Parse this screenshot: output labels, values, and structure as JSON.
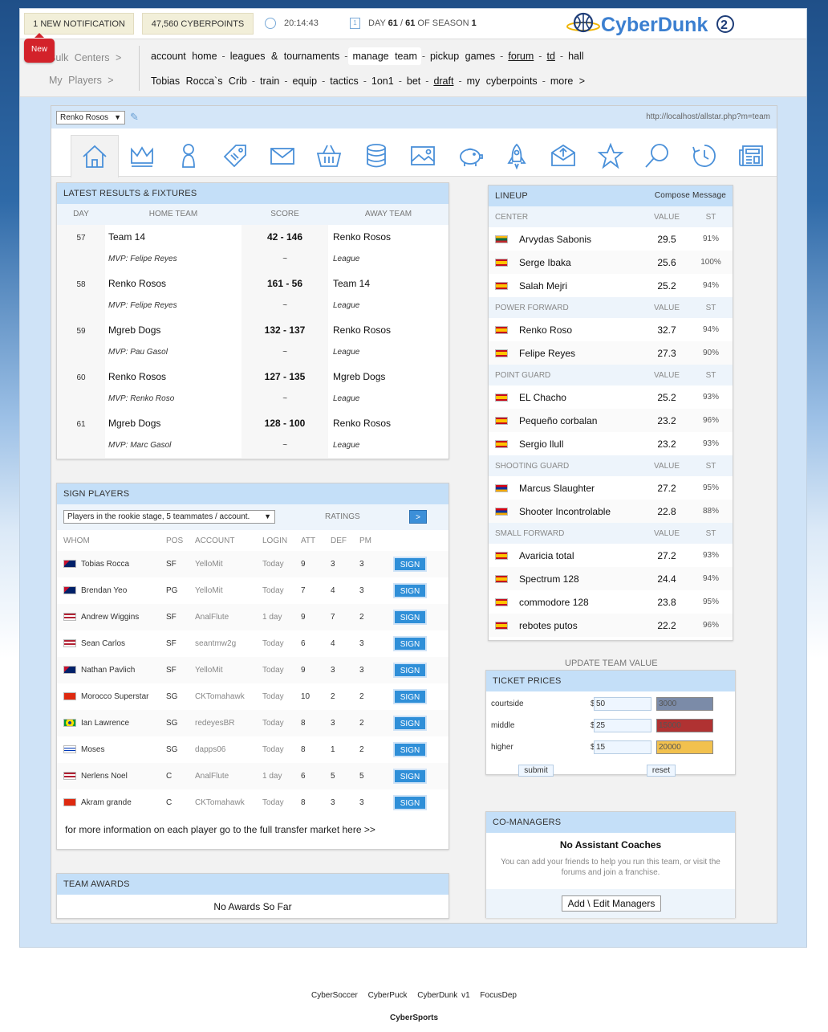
{
  "topbar": {
    "notification": "1 NEW NOTIFICATION",
    "cyberpoints": "47,560 CYBERPOINTS",
    "time": "20:14:43",
    "day_prefix": "DAY",
    "day_current": "61",
    "day_sep": "/",
    "day_total": "61",
    "season_prefix": "OF SEASON",
    "season": "1",
    "new_badge": "New",
    "logo_text": "CyberDunk"
  },
  "nav": {
    "left1": "Bulk  Centers  >",
    "left2": "My  Players  >",
    "row1": [
      "account  home",
      "leagues  &  tournaments",
      "manage  team",
      "pickup  games",
      "forum",
      "td",
      "hall"
    ],
    "row2": [
      "Tobias  Rocca`s  Crib",
      "train",
      "equip",
      "tactics",
      "1on1",
      "bet",
      "draft",
      "my  cyberpoints",
      "more  >"
    ]
  },
  "main": {
    "team_select": "Renko Rosos",
    "url": "http://localhost/allstar.php?m=team",
    "tabs": [
      "home-icon",
      "crown-icon",
      "player-icon",
      "tag-icon",
      "mail-icon",
      "basket-icon",
      "database-icon",
      "image-icon",
      "piggy-bank-icon",
      "rocket-icon",
      "inbox-icon",
      "star-icon",
      "search-icon",
      "clock-icon",
      "newspaper-icon"
    ]
  },
  "results": {
    "title": "LATEST RESULTS & FIXTURES",
    "cols": [
      "DAY",
      "HOME TEAM",
      "SCORE",
      "AWAY TEAM"
    ],
    "rows": [
      {
        "day": "57",
        "home": "Team 14",
        "mvp": "MVP: Felipe Reyes",
        "score": "42 - 146",
        "tilde": "~",
        "away": "Renko Rosos",
        "comp": "League"
      },
      {
        "day": "58",
        "home": "Renko Rosos",
        "mvp": "MVP: Felipe Reyes",
        "score": "161 - 56",
        "tilde": "~",
        "away": "Team 14",
        "comp": "League"
      },
      {
        "day": "59",
        "home": "Mgreb Dogs",
        "mvp": "MVP: Pau Gasol",
        "score": "132 - 137",
        "tilde": "~",
        "away": "Renko Rosos",
        "comp": "League"
      },
      {
        "day": "60",
        "home": "Renko Rosos",
        "mvp": "MVP: Renko Roso",
        "score": "127 - 135",
        "tilde": "~",
        "away": "Mgreb Dogs",
        "comp": "League"
      },
      {
        "day": "61",
        "home": "Mgreb Dogs",
        "mvp": "MVP: Marc Gasol",
        "score": "128 - 100",
        "tilde": "~",
        "away": "Renko Rosos",
        "comp": "League"
      }
    ]
  },
  "sign": {
    "title": "SIGN PLAYERS",
    "filter": "Players in the rookie stage, 5 teammates / account.",
    "ratings": "RATINGS",
    "go": ">",
    "cols": [
      "WHOM",
      "POS",
      "ACCOUNT",
      "LOGIN",
      "ATT",
      "DEF",
      "PM"
    ],
    "button": "SIGN",
    "rows": [
      {
        "flag": "au",
        "name": "Tobias Rocca",
        "pos": "SF",
        "acc": "YelloMit",
        "login": "Today",
        "att": "9",
        "def": "3",
        "pm": "3"
      },
      {
        "flag": "au",
        "name": "Brendan Yeo",
        "pos": "PG",
        "acc": "YelloMit",
        "login": "Today",
        "att": "7",
        "def": "4",
        "pm": "3"
      },
      {
        "flag": "us",
        "name": "Andrew Wiggins",
        "pos": "SF",
        "acc": "AnalFlute",
        "login": "1 day",
        "att": "9",
        "def": "7",
        "pm": "2"
      },
      {
        "flag": "us",
        "name": "Sean Carlos",
        "pos": "SF",
        "acc": "seantmw2g",
        "login": "Today",
        "att": "6",
        "def": "4",
        "pm": "3"
      },
      {
        "flag": "au",
        "name": "Nathan Pavlich",
        "pos": "SF",
        "acc": "YelloMit",
        "login": "Today",
        "att": "9",
        "def": "3",
        "pm": "3"
      },
      {
        "flag": "cn",
        "name": "Morocco Superstar",
        "pos": "SG",
        "acc": "CKTomahawk",
        "login": "Today",
        "att": "10",
        "def": "2",
        "pm": "2"
      },
      {
        "flag": "br",
        "name": "Ian Lawrence",
        "pos": "SG",
        "acc": "redeyesBR",
        "login": "Today",
        "att": "8",
        "def": "3",
        "pm": "2"
      },
      {
        "flag": "il",
        "name": "Moses",
        "pos": "SG",
        "acc": "dapps06",
        "login": "Today",
        "att": "8",
        "def": "1",
        "pm": "2"
      },
      {
        "flag": "us",
        "name": "Nerlens Noel",
        "pos": "C",
        "acc": "AnalFlute",
        "login": "1 day",
        "att": "6",
        "def": "5",
        "pm": "5"
      },
      {
        "flag": "cn",
        "name": "Akram grande",
        "pos": "C",
        "acc": "CKTomahawk",
        "login": "Today",
        "att": "8",
        "def": "3",
        "pm": "3"
      }
    ],
    "footer": "for more information on each player go to the full transfer market here >>"
  },
  "awards": {
    "title": "TEAM AWARDS",
    "text": "No Awards So Far"
  },
  "lineup": {
    "title": "LINEUP",
    "compose": "Compose Message",
    "value_label": "VALUE",
    "st_label": "ST",
    "sections": [
      {
        "name": "CENTER",
        "players": [
          {
            "flag": "lt",
            "name": "Arvydas Sabonis",
            "value": "29.5",
            "st": "91%"
          },
          {
            "flag": "es",
            "name": "Serge Ibaka",
            "value": "25.6",
            "st": "100%"
          },
          {
            "flag": "es",
            "name": "Salah Mejri",
            "value": "25.2",
            "st": "94%"
          }
        ]
      },
      {
        "name": "POWER FORWARD",
        "players": [
          {
            "flag": "es",
            "name": "Renko Roso",
            "value": "32.7",
            "st": "94%"
          },
          {
            "flag": "es",
            "name": "Felipe Reyes",
            "value": "27.3",
            "st": "90%"
          }
        ]
      },
      {
        "name": "POINT GUARD",
        "players": [
          {
            "flag": "es",
            "name": "EL Chacho",
            "value": "25.2",
            "st": "93%"
          },
          {
            "flag": "es",
            "name": "Pequeño corbalan",
            "value": "23.2",
            "st": "96%"
          },
          {
            "flag": "es",
            "name": "Sergio llull",
            "value": "23.2",
            "st": "93%"
          }
        ]
      },
      {
        "name": "SHOOTING GUARD",
        "players": [
          {
            "flag": "am",
            "name": "Marcus Slaughter",
            "value": "27.2",
            "st": "95%"
          },
          {
            "flag": "am",
            "name": "Shooter Incontrolable",
            "value": "22.8",
            "st": "88%"
          }
        ]
      },
      {
        "name": "SMALL FORWARD",
        "players": [
          {
            "flag": "es",
            "name": "Avaricia total",
            "value": "27.2",
            "st": "93%"
          },
          {
            "flag": "es",
            "name": "Spectrum 128",
            "value": "24.4",
            "st": "94%"
          },
          {
            "flag": "es",
            "name": "commodore 128",
            "value": "23.8",
            "st": "95%"
          },
          {
            "flag": "es",
            "name": "rebotes putos",
            "value": "22.2",
            "st": "96%"
          }
        ]
      }
    ],
    "update": "UPDATE TEAM VALUE"
  },
  "tickets": {
    "title": "TICKET PRICES",
    "currency": "$",
    "rows": [
      {
        "label": "courtside",
        "price": "50",
        "capacity": "3000",
        "color": "#7b8ba8"
      },
      {
        "label": "middle",
        "price": "25",
        "capacity": "15000",
        "color": "#b03232"
      },
      {
        "label": "higher",
        "price": "15",
        "capacity": "20000",
        "color": "#f2c14e"
      }
    ],
    "submit": "submit",
    "reset": "reset"
  },
  "comanagers": {
    "title": "CO-MANAGERS",
    "heading": "No Assistant Coaches",
    "text": "You can add your friends to help you run this team, or visit the forums and join a franchise.",
    "button": "Add \\ Edit Managers"
  },
  "footer": {
    "links": [
      "CyberSoccer",
      "CyberPuck",
      "CyberDunk v1",
      "FocusDep"
    ],
    "brand": "CyberSports"
  },
  "colors": {
    "accent": "#2f8fd8",
    "header_blue": "#c4dff8",
    "logo_blue": "#3b7fd0",
    "logo_gold": "#f0b400"
  }
}
